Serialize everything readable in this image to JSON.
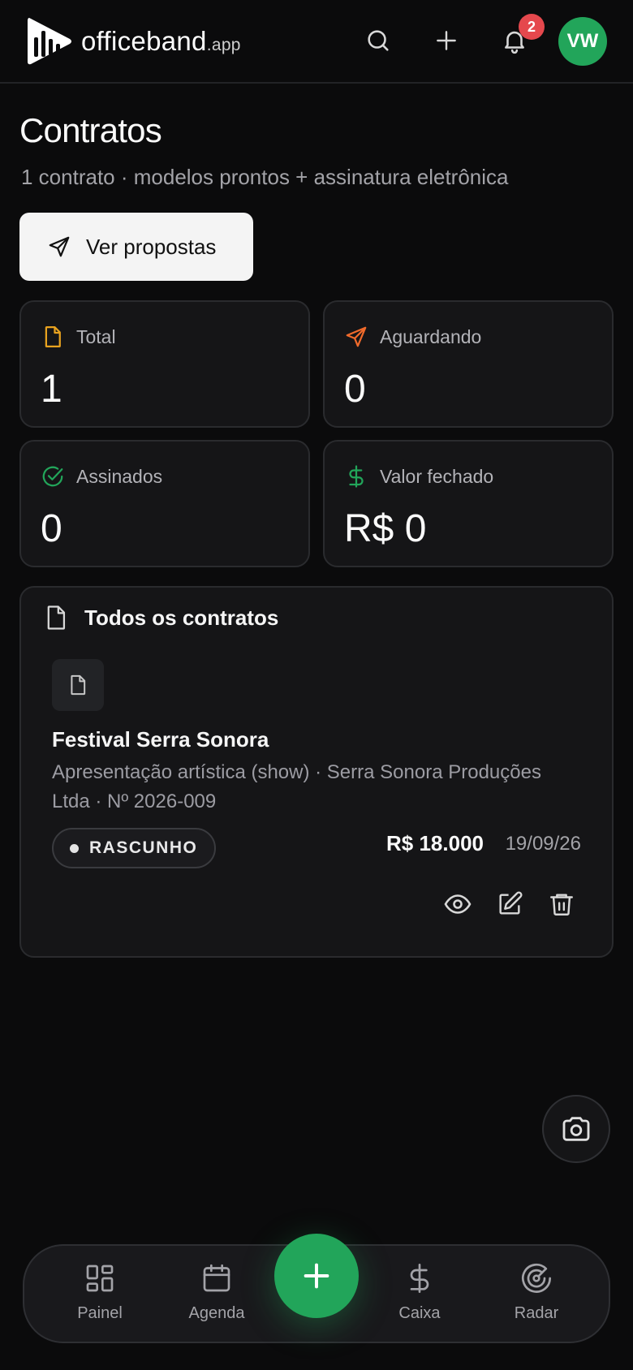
{
  "header": {
    "brand": "officeband",
    "brand_suffix": ".app",
    "notification_count": "2",
    "avatar_initials": "VW"
  },
  "page": {
    "title": "Contratos",
    "subtitle": "1 contrato · modelos prontos + assinatura eletrônica",
    "primary_action": "Ver propostas"
  },
  "stats": [
    {
      "label": "Total",
      "value": "1",
      "icon": "file-icon",
      "color": "#e8a21f"
    },
    {
      "label": "Aguardando",
      "value": "0",
      "icon": "send-icon",
      "color": "#f06a2b"
    },
    {
      "label": "Assinados",
      "value": "0",
      "icon": "check-circle-icon",
      "color": "#22a55a"
    },
    {
      "label": "Valor fechado",
      "value": "R$ 0",
      "icon": "dollar-icon",
      "color": "#22a55a"
    }
  ],
  "contracts": {
    "heading": "Todos os contratos",
    "items": [
      {
        "title": "Festival Serra Sonora",
        "description": "Apresentação artística (show) · Serra Sonora Produções Ltda · Nº 2026-009",
        "status": "RASCUNHO",
        "amount": "R$ 18.000",
        "date": "19/09/26"
      }
    ]
  },
  "nav": {
    "items": [
      {
        "label": "Painel",
        "icon": "dashboard-icon"
      },
      {
        "label": "Agenda",
        "icon": "calendar-icon"
      },
      {
        "label": "Caixa",
        "icon": "dollar-icon"
      },
      {
        "label": "Radar",
        "icon": "radar-icon"
      }
    ]
  },
  "colors": {
    "accent": "#22a55a",
    "badge": "#e5484d",
    "background": "#0b0b0c",
    "card": "#151517"
  }
}
